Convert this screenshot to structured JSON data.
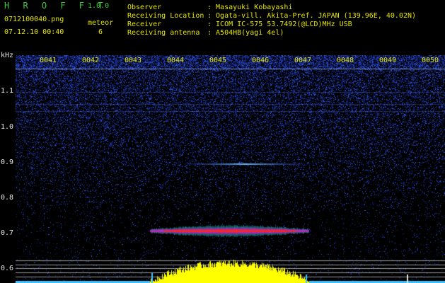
{
  "header": {
    "app_title": "H R O F F T",
    "version": "1.0.0",
    "filename": "0712100040.png",
    "counter_label": "meteor",
    "counter_value": "6",
    "datetime": "07.12.10 00:40"
  },
  "info": {
    "labels": [
      "Observer",
      "Receiving Location",
      "Receiver",
      "Receiving antenna"
    ],
    "values": [
      ": Masayuki Kobayashi",
      ": Ogata-vill. Akita-Pref. JAPAN (139.96E, 40.02N)",
      ": ICOM IC-575 53.7492(@LCD)MHz USB",
      ": A504HB(yagi 4el)"
    ]
  },
  "spectrogram": {
    "y_unit": "kHz",
    "y_ticks": [
      "1.1",
      "1.0",
      "0.9",
      "0.8",
      "0.7",
      "0.6"
    ],
    "x_ticks": [
      "0041",
      "0042",
      "0043",
      "0044",
      "0045",
      "0046",
      "0047",
      "0048",
      "0049",
      "0050"
    ],
    "colors": {
      "background": "#000000",
      "noise": "#1a2aa8",
      "signal_core": "#ff2020",
      "signal_mid": "#20c8c8",
      "amplitude": "#ffff00",
      "amplitude_edge": "#40c0ff"
    }
  }
}
